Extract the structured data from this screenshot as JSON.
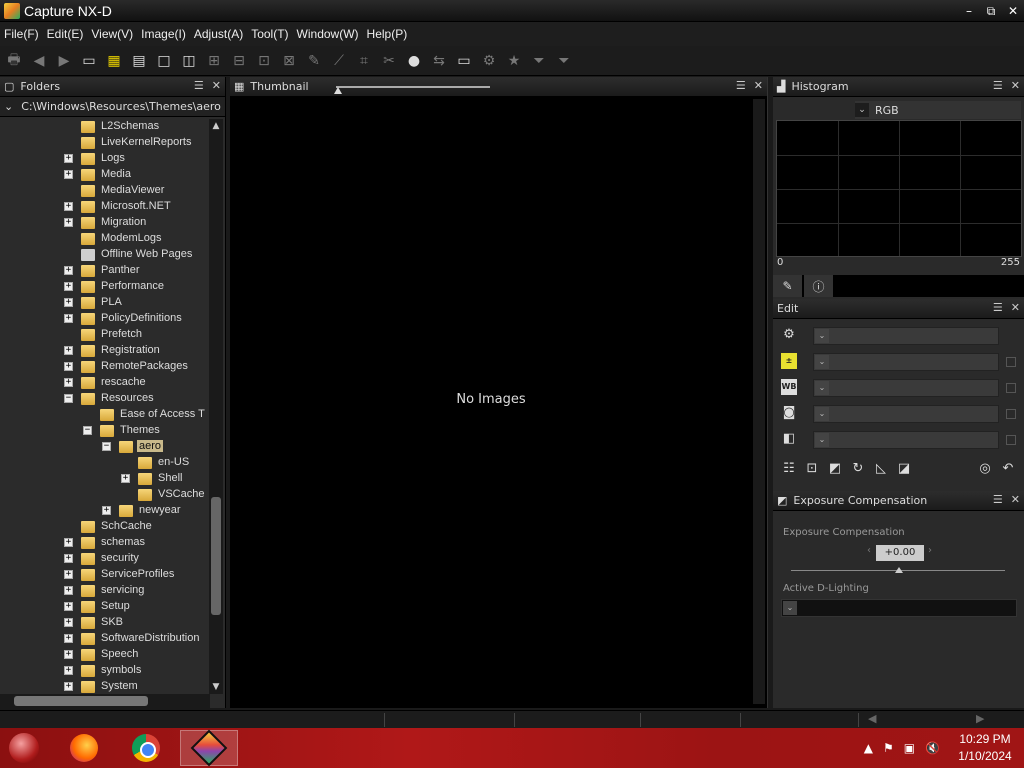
{
  "window": {
    "title": "Capture NX-D",
    "minimize": "–",
    "restore": "⧉",
    "close": "✕"
  },
  "menu": [
    "File(F)",
    "Edit(E)",
    "View(V)",
    "Image(I)",
    "Adjust(A)",
    "Tool(T)",
    "Window(W)",
    "Help(P)"
  ],
  "folders_panel": {
    "title": "Folders",
    "path": "C:\\Windows\\Resources\\Themes\\aero",
    "items": [
      {
        "label": "L2Schemas",
        "depth": 0,
        "expander": ""
      },
      {
        "label": "LiveKernelReports",
        "depth": 0,
        "expander": ""
      },
      {
        "label": "Logs",
        "depth": 0,
        "expander": "+"
      },
      {
        "label": "Media",
        "depth": 0,
        "expander": "+"
      },
      {
        "label": "MediaViewer",
        "depth": 0,
        "expander": ""
      },
      {
        "label": "Microsoft.NET",
        "depth": 0,
        "expander": "+"
      },
      {
        "label": "Migration",
        "depth": 0,
        "expander": "+"
      },
      {
        "label": "ModemLogs",
        "depth": 0,
        "expander": ""
      },
      {
        "label": "Offline Web Pages",
        "depth": 0,
        "expander": "",
        "special": true
      },
      {
        "label": "Panther",
        "depth": 0,
        "expander": "+"
      },
      {
        "label": "Performance",
        "depth": 0,
        "expander": "+"
      },
      {
        "label": "PLA",
        "depth": 0,
        "expander": "+"
      },
      {
        "label": "PolicyDefinitions",
        "depth": 0,
        "expander": "+"
      },
      {
        "label": "Prefetch",
        "depth": 0,
        "expander": ""
      },
      {
        "label": "Registration",
        "depth": 0,
        "expander": "+"
      },
      {
        "label": "RemotePackages",
        "depth": 0,
        "expander": "+"
      },
      {
        "label": "rescache",
        "depth": 0,
        "expander": "+"
      },
      {
        "label": "Resources",
        "depth": 0,
        "expander": "−"
      },
      {
        "label": "Ease of Access T",
        "depth": 1,
        "expander": ""
      },
      {
        "label": "Themes",
        "depth": 1,
        "expander": "−"
      },
      {
        "label": "aero",
        "depth": 2,
        "expander": "−",
        "selected": true
      },
      {
        "label": "en-US",
        "depth": 3,
        "expander": ""
      },
      {
        "label": "Shell",
        "depth": 3,
        "expander": "+"
      },
      {
        "label": "VSCache",
        "depth": 3,
        "expander": ""
      },
      {
        "label": "newyear",
        "depth": 2,
        "expander": "+"
      },
      {
        "label": "SchCache",
        "depth": 0,
        "expander": ""
      },
      {
        "label": "schemas",
        "depth": 0,
        "expander": "+"
      },
      {
        "label": "security",
        "depth": 0,
        "expander": "+"
      },
      {
        "label": "ServiceProfiles",
        "depth": 0,
        "expander": "+"
      },
      {
        "label": "servicing",
        "depth": 0,
        "expander": "+"
      },
      {
        "label": "Setup",
        "depth": 0,
        "expander": "+"
      },
      {
        "label": "SKB",
        "depth": 0,
        "expander": "+"
      },
      {
        "label": "SoftwareDistribution",
        "depth": 0,
        "expander": "+"
      },
      {
        "label": "Speech",
        "depth": 0,
        "expander": "+"
      },
      {
        "label": "symbols",
        "depth": 0,
        "expander": "+"
      },
      {
        "label": "System",
        "depth": 0,
        "expander": "+"
      }
    ]
  },
  "thumbnail_panel": {
    "title": "Thumbnail",
    "empty_message": "No Images"
  },
  "histogram_panel": {
    "title": "Histogram",
    "channel": "RGB",
    "min_label": "0",
    "max_label": "255"
  },
  "edit_panel": {
    "title": "Edit"
  },
  "exposure_panel": {
    "title": "Exposure Compensation",
    "label": "Exposure Compensation",
    "value": "+0.00",
    "adl_label": "Active D-Lighting"
  },
  "taskbar": {
    "time": "10:29 PM",
    "date": "1/10/2024"
  }
}
